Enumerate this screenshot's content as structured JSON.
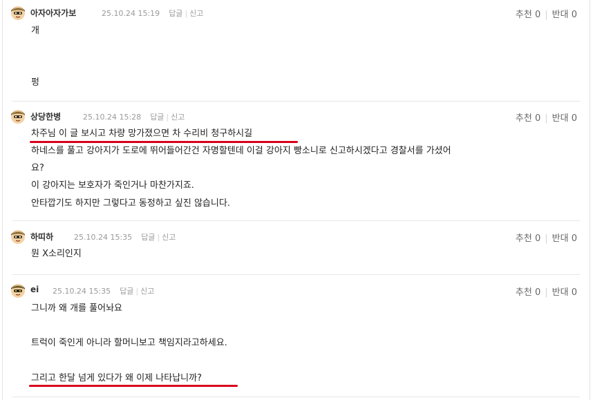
{
  "comments": [
    {
      "nickname": "아자아자가보",
      "date": "25.10.24 15:19",
      "reply": "답글",
      "report": "신고",
      "upvote_label": "추천",
      "upvote_count": "0",
      "downvote_label": "반대",
      "downvote_count": "0",
      "lines": [
        "개",
        "펑"
      ]
    },
    {
      "nickname": "상당한병",
      "date": "25.10.24 15:28",
      "reply": "답글",
      "report": "신고",
      "upvote_label": "추천",
      "upvote_count": "0",
      "downvote_label": "반대",
      "downvote_count": "0",
      "lines": [
        "차주님 이 글 보시고 차량 망가졌으면 차 수리비 청구하시길",
        "하네스를 풀고 강아지가 도로에 뛰어들어간건 자명할텐데 이걸 강아지 빵소니로 신고하시겠다고 경찰서를 가셨어",
        "요?",
        "이 강아지는 보호자가 죽인거나 마찬가지죠.",
        "안타깝기도 하지만 그렇다고 동정하고 싶진 않습니다."
      ]
    },
    {
      "nickname": "하띠하",
      "date": "25.10.24 15:35",
      "reply": "답글",
      "report": "신고",
      "upvote_label": "추천",
      "upvote_count": "0",
      "downvote_label": "반대",
      "downvote_count": "0",
      "lines": [
        "뭔 X소리인지"
      ]
    },
    {
      "nickname": "ei",
      "date": "25.10.24 15:35",
      "reply": "답글",
      "report": "신고",
      "upvote_label": "추천",
      "upvote_count": "0",
      "downvote_label": "반대",
      "downvote_count": "0",
      "lines": [
        "그니까 왜 개를 풀어놔요",
        "트럭이 죽인게 아니라 할머니보고 책임지라고하세요.",
        "그리고 한달 넘게 있다가 왜 이제 나타납니까?"
      ]
    }
  ],
  "colors": {
    "highlight_underline": "#d9001b",
    "meta_text": "#999999",
    "separator": "#e6e6e6"
  },
  "icons": [
    "soldier-avatar-icon"
  ]
}
